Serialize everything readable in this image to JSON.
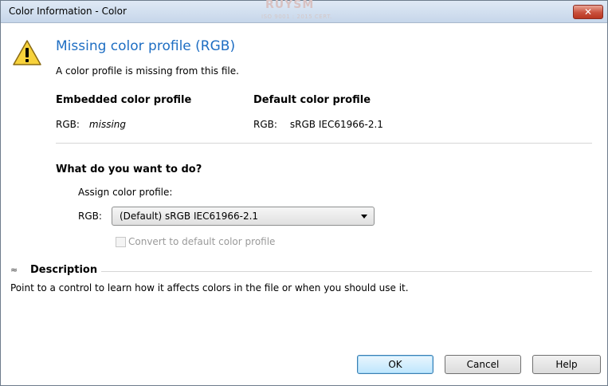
{
  "window": {
    "title": "Color Information - Color",
    "watermark": "RUYSM",
    "watermark_sub": "ISO 9001 : 2015 CERT.",
    "close_symbol": "✕"
  },
  "main": {
    "heading": "Missing color profile (RGB)",
    "subtext": "A color profile is missing from this file.",
    "embedded": {
      "title": "Embedded color profile",
      "label": "RGB:",
      "value": "missing"
    },
    "default": {
      "title": "Default color profile",
      "label": "RGB:",
      "value": "sRGB IEC61966-2.1"
    },
    "question": "What do you want to do?",
    "assign_label": "Assign color profile:",
    "rgb_label": "RGB:",
    "select_value": "(Default) sRGB IEC61966-2.1",
    "convert_label": "Convert to default color profile",
    "convert_checked": false
  },
  "description": {
    "toggle_symbol": "≈",
    "title": "Description",
    "text": "Point to a control to learn how it affects colors in the file or when you should use it."
  },
  "buttons": {
    "ok": "OK",
    "cancel": "Cancel",
    "help": "Help"
  },
  "icons": {
    "warning": "warning-icon"
  },
  "colors": {
    "heading": "#1e6ec3",
    "warning_fill": "#f7d23b",
    "close_red": "#c9503c"
  }
}
